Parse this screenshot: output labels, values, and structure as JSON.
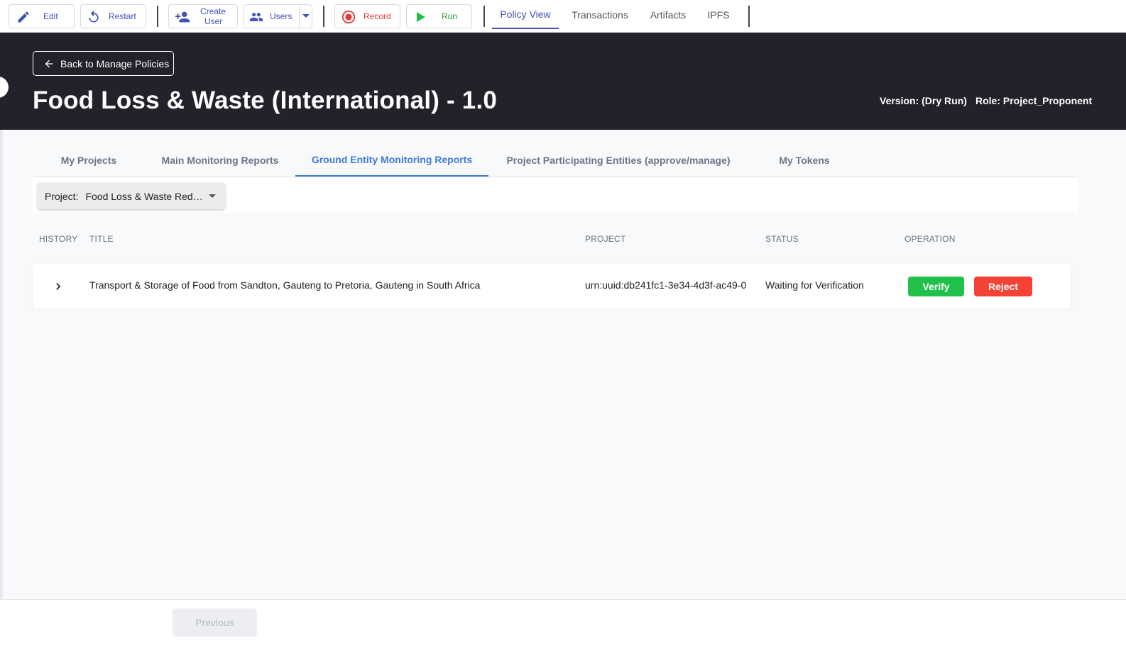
{
  "toolbar": {
    "edit_label": "Edit",
    "restart_label": "Restart",
    "create_user_label_line1": "Create",
    "create_user_label_line2": "User",
    "users_label": "Users",
    "record_label": "Record",
    "run_label": "Run",
    "nav_tabs": [
      "Policy View",
      "Transactions",
      "Artifacts",
      "IPFS"
    ],
    "active_nav": "Policy View"
  },
  "header": {
    "back_label": "Back to Manage Policies",
    "title": "Food Loss & Waste (International) - 1.0",
    "version": "Version: (Dry Run)",
    "role": "Role: Project_Proponent"
  },
  "subtabs": [
    "My Projects",
    "Main Monitoring Reports",
    "Ground Entity Monitoring Reports",
    "Project Participating Entities (approve/manage)",
    "My Tokens"
  ],
  "active_subtab": "Ground Entity Monitoring Reports",
  "filter": {
    "label": "Project:",
    "value": "Food Loss & Waste Reduc..."
  },
  "table": {
    "columns": [
      "HISTORY",
      "TITLE",
      "PROJECT",
      "STATUS",
      "OPERATION"
    ],
    "rows": [
      {
        "title": "Transport & Storage of Food from Sandton, Gauteng to Pretoria, Gauteng in South Africa",
        "project": "urn:uuid:db241fc1-3e34-4d3f-ac49-0",
        "status": "Waiting for Verification",
        "verify_label": "Verify",
        "reject_label": "Reject"
      }
    ]
  },
  "pagination": {
    "previous_label": "Previous"
  },
  "colors": {
    "accent": "#3f51b5",
    "subtab_active": "#3f79d9",
    "header_bg": "#22232a",
    "verify": "#1fc14a",
    "reject": "#f44336",
    "record": "#e53935",
    "run": "#1fc14a"
  },
  "icons": [
    "pencil-icon",
    "restart-icon",
    "person-add-icon",
    "people-icon",
    "caret-down-icon",
    "record-icon",
    "play-icon",
    "arrow-left-icon",
    "chevron-right-icon"
  ]
}
